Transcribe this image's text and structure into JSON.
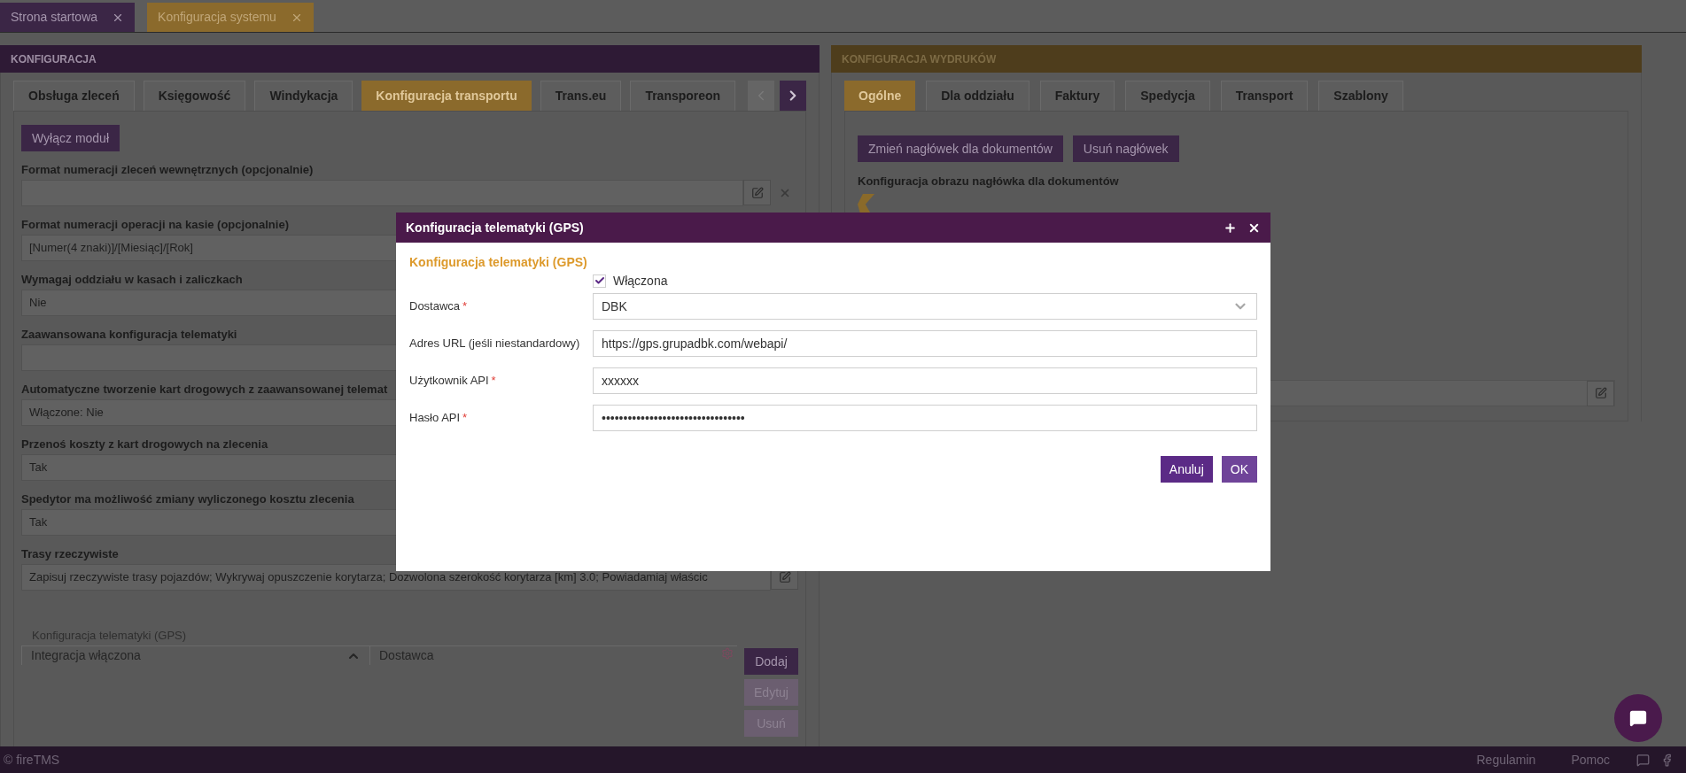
{
  "app_tabs": [
    {
      "label": "Strona startowa",
      "selected": false
    },
    {
      "label": "Konfiguracja systemu",
      "selected": true
    }
  ],
  "left_panel": {
    "title": "KONFIGURACJA",
    "tabs": [
      {
        "label": "Obsługa zleceń",
        "selected": false
      },
      {
        "label": "Księgowość",
        "selected": false
      },
      {
        "label": "Windykacja",
        "selected": false
      },
      {
        "label": "Konfiguracja transportu",
        "selected": true
      },
      {
        "label": "Trans.eu",
        "selected": false
      },
      {
        "label": "Transporeon",
        "selected": false
      }
    ],
    "tab_scroll": {
      "prev_disabled": true,
      "next_disabled": false
    },
    "module_button": "Wyłącz moduł",
    "fields": [
      {
        "label": "Format numeracji zleceń wewnętrznych (opcjonalnie)",
        "kind": "edit_clear"
      },
      {
        "label": "Format numeracji operacji na kasie (opcjonalnie)",
        "value": "[Numer(4 znaki)]/[Miesiąc]/[Rok]",
        "kind": "text"
      },
      {
        "label": "Wymagaj oddziału w kasach i zaliczkach",
        "value": "Nie",
        "kind": "text"
      },
      {
        "label": "Zaawansowana konfiguracja telematyki",
        "kind": "text"
      },
      {
        "label": "Automatyczne tworzenie kart drogowych z zaawansowanej telemat",
        "value": "Włączone: Nie",
        "kind": "text"
      },
      {
        "label": "Przenoś koszty z kart drogowych na zlecenia",
        "value": "Tak",
        "kind": "text"
      },
      {
        "label": "Spedytor ma możliwość zmiany wyliczonego kosztu zlecenia",
        "value": "Tak",
        "kind": "text"
      },
      {
        "label": "Trasy rzeczywiste",
        "value": "Zapisuj rzeczywiste trasy pojazdów; Wykrywaj opuszczenie korytarza; Dozwolona szerokość korytarza [km] 3.0; Powiadamiaj właścic",
        "kind": "edit"
      }
    ],
    "gps_table": {
      "caption": "Konfiguracja telematyki (GPS)",
      "columns": [
        {
          "label": "Integracja włączona",
          "sorted": true
        },
        {
          "label": "Dostawca",
          "sorted": false
        }
      ],
      "buttons": [
        {
          "label": "Dodaj",
          "disabled": false
        },
        {
          "label": "Edytuj",
          "disabled": true
        },
        {
          "label": "Usuń",
          "disabled": true
        }
      ]
    }
  },
  "right_panel": {
    "title": "KONFIGURACJA WYDRUKÓW",
    "tabs": [
      {
        "label": "Ogólne",
        "selected": true
      },
      {
        "label": "Dla oddziału",
        "selected": false
      },
      {
        "label": "Faktury",
        "selected": false
      },
      {
        "label": "Spedycja",
        "selected": false
      },
      {
        "label": "Transport",
        "selected": false
      },
      {
        "label": "Szablony",
        "selected": false
      }
    ],
    "buttons": [
      "Zmień nagłówek dla dokumentów",
      "Usuń nagłówek"
    ],
    "image_label": "Konfiguracja obrazu nagłówka dla dokumentów"
  },
  "dialog": {
    "title": "Konfiguracja telematyki (GPS)",
    "section_title": "Konfiguracja telematyki (GPS)",
    "enabled": {
      "label": "Włączona",
      "checked": true
    },
    "required_mark": "*",
    "fields": [
      {
        "label": "Dostawca",
        "required": true,
        "kind": "select",
        "value": "DBK"
      },
      {
        "label": "Adres URL (jeśli niestandardowy)",
        "required": false,
        "kind": "input",
        "value": "https://gps.grupadbk.com/webapi/"
      },
      {
        "label": "Użytkownik API",
        "required": true,
        "kind": "input",
        "value": "xxxxxx"
      },
      {
        "label": "Hasło API",
        "required": true,
        "kind": "input",
        "value": "•••••••••••••••••••••••••••••••••"
      }
    ],
    "buttons": [
      {
        "label": "Anuluj",
        "kind": "secondary"
      },
      {
        "label": "OK",
        "kind": "primary"
      }
    ]
  },
  "footer": {
    "copyright": "© fireTMS",
    "links": [
      "Regulamin",
      "Pomoc"
    ]
  }
}
